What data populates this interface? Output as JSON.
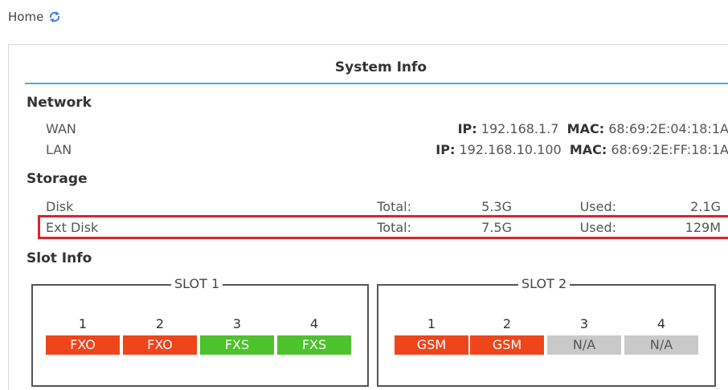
{
  "breadcrumb": {
    "home": "Home"
  },
  "panel": {
    "title": "System Info"
  },
  "network": {
    "heading": "Network",
    "rows": [
      {
        "name": "WAN",
        "ip_label": "IP:",
        "ip": "192.168.1.7",
        "mac_label": "MAC:",
        "mac": "68:69:2E:04:18:1A"
      },
      {
        "name": "LAN",
        "ip_label": "IP:",
        "ip": "192.168.10.100",
        "mac_label": "MAC:",
        "mac": "68:69:2E:FF:18:1A"
      }
    ]
  },
  "storage": {
    "heading": "Storage",
    "rows": [
      {
        "name": "Disk",
        "total_label": "Total:",
        "total": "5.3G",
        "used_label": "Used:",
        "used": "2.1G"
      },
      {
        "name": "Ext Disk",
        "total_label": "Total:",
        "total": "7.5G",
        "used_label": "Used:",
        "used": "129M"
      }
    ]
  },
  "slots": {
    "heading": "Slot Info",
    "slot1": {
      "title": "SLOT 1",
      "ports": [
        {
          "num": "1",
          "type": "FXO"
        },
        {
          "num": "2",
          "type": "FXO"
        },
        {
          "num": "3",
          "type": "FXS"
        },
        {
          "num": "4",
          "type": "FXS"
        }
      ]
    },
    "slot2": {
      "title": "SLOT 2",
      "ports": [
        {
          "num": "1",
          "type": "GSM"
        },
        {
          "num": "2",
          "type": "GSM"
        },
        {
          "num": "3",
          "type": "N/A"
        },
        {
          "num": "4",
          "type": "N/A"
        }
      ]
    }
  },
  "colors": {
    "accent_rule": "#5aa4d6",
    "highlight": "#e02030",
    "fxo": "#f0441a",
    "fxs": "#4dc22c",
    "na": "#c9c9c9"
  },
  "icons": {
    "refresh": "refresh-icon"
  }
}
